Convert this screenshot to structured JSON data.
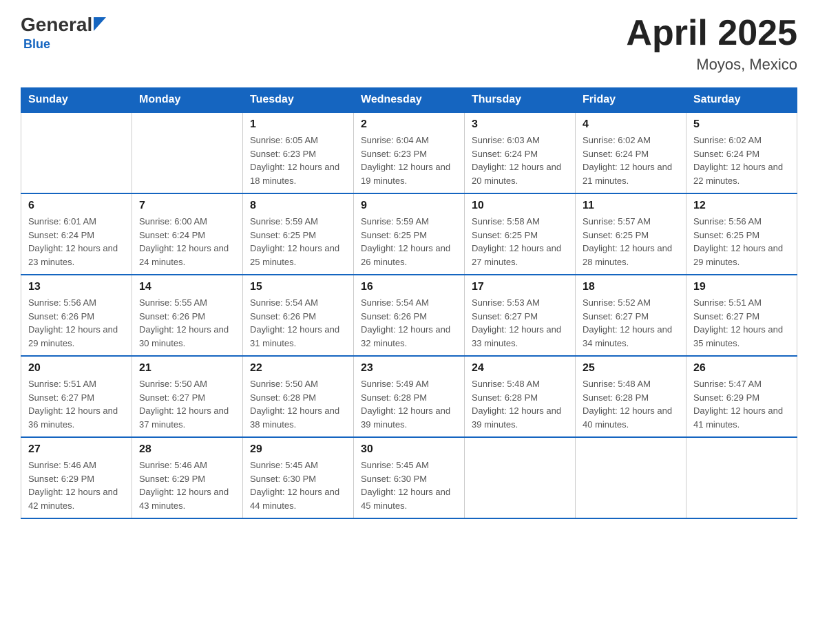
{
  "header": {
    "logo_general": "General",
    "logo_blue": "Blue",
    "month_year": "April 2025",
    "location": "Moyos, Mexico"
  },
  "days_of_week": [
    "Sunday",
    "Monday",
    "Tuesday",
    "Wednesday",
    "Thursday",
    "Friday",
    "Saturday"
  ],
  "weeks": [
    [
      {
        "day": "",
        "sunrise": "",
        "sunset": "",
        "daylight": ""
      },
      {
        "day": "",
        "sunrise": "",
        "sunset": "",
        "daylight": ""
      },
      {
        "day": "1",
        "sunrise": "Sunrise: 6:05 AM",
        "sunset": "Sunset: 6:23 PM",
        "daylight": "Daylight: 12 hours and 18 minutes."
      },
      {
        "day": "2",
        "sunrise": "Sunrise: 6:04 AM",
        "sunset": "Sunset: 6:23 PM",
        "daylight": "Daylight: 12 hours and 19 minutes."
      },
      {
        "day": "3",
        "sunrise": "Sunrise: 6:03 AM",
        "sunset": "Sunset: 6:24 PM",
        "daylight": "Daylight: 12 hours and 20 minutes."
      },
      {
        "day": "4",
        "sunrise": "Sunrise: 6:02 AM",
        "sunset": "Sunset: 6:24 PM",
        "daylight": "Daylight: 12 hours and 21 minutes."
      },
      {
        "day": "5",
        "sunrise": "Sunrise: 6:02 AM",
        "sunset": "Sunset: 6:24 PM",
        "daylight": "Daylight: 12 hours and 22 minutes."
      }
    ],
    [
      {
        "day": "6",
        "sunrise": "Sunrise: 6:01 AM",
        "sunset": "Sunset: 6:24 PM",
        "daylight": "Daylight: 12 hours and 23 minutes."
      },
      {
        "day": "7",
        "sunrise": "Sunrise: 6:00 AM",
        "sunset": "Sunset: 6:24 PM",
        "daylight": "Daylight: 12 hours and 24 minutes."
      },
      {
        "day": "8",
        "sunrise": "Sunrise: 5:59 AM",
        "sunset": "Sunset: 6:25 PM",
        "daylight": "Daylight: 12 hours and 25 minutes."
      },
      {
        "day": "9",
        "sunrise": "Sunrise: 5:59 AM",
        "sunset": "Sunset: 6:25 PM",
        "daylight": "Daylight: 12 hours and 26 minutes."
      },
      {
        "day": "10",
        "sunrise": "Sunrise: 5:58 AM",
        "sunset": "Sunset: 6:25 PM",
        "daylight": "Daylight: 12 hours and 27 minutes."
      },
      {
        "day": "11",
        "sunrise": "Sunrise: 5:57 AM",
        "sunset": "Sunset: 6:25 PM",
        "daylight": "Daylight: 12 hours and 28 minutes."
      },
      {
        "day": "12",
        "sunrise": "Sunrise: 5:56 AM",
        "sunset": "Sunset: 6:25 PM",
        "daylight": "Daylight: 12 hours and 29 minutes."
      }
    ],
    [
      {
        "day": "13",
        "sunrise": "Sunrise: 5:56 AM",
        "sunset": "Sunset: 6:26 PM",
        "daylight": "Daylight: 12 hours and 29 minutes."
      },
      {
        "day": "14",
        "sunrise": "Sunrise: 5:55 AM",
        "sunset": "Sunset: 6:26 PM",
        "daylight": "Daylight: 12 hours and 30 minutes."
      },
      {
        "day": "15",
        "sunrise": "Sunrise: 5:54 AM",
        "sunset": "Sunset: 6:26 PM",
        "daylight": "Daylight: 12 hours and 31 minutes."
      },
      {
        "day": "16",
        "sunrise": "Sunrise: 5:54 AM",
        "sunset": "Sunset: 6:26 PM",
        "daylight": "Daylight: 12 hours and 32 minutes."
      },
      {
        "day": "17",
        "sunrise": "Sunrise: 5:53 AM",
        "sunset": "Sunset: 6:27 PM",
        "daylight": "Daylight: 12 hours and 33 minutes."
      },
      {
        "day": "18",
        "sunrise": "Sunrise: 5:52 AM",
        "sunset": "Sunset: 6:27 PM",
        "daylight": "Daylight: 12 hours and 34 minutes."
      },
      {
        "day": "19",
        "sunrise": "Sunrise: 5:51 AM",
        "sunset": "Sunset: 6:27 PM",
        "daylight": "Daylight: 12 hours and 35 minutes."
      }
    ],
    [
      {
        "day": "20",
        "sunrise": "Sunrise: 5:51 AM",
        "sunset": "Sunset: 6:27 PM",
        "daylight": "Daylight: 12 hours and 36 minutes."
      },
      {
        "day": "21",
        "sunrise": "Sunrise: 5:50 AM",
        "sunset": "Sunset: 6:27 PM",
        "daylight": "Daylight: 12 hours and 37 minutes."
      },
      {
        "day": "22",
        "sunrise": "Sunrise: 5:50 AM",
        "sunset": "Sunset: 6:28 PM",
        "daylight": "Daylight: 12 hours and 38 minutes."
      },
      {
        "day": "23",
        "sunrise": "Sunrise: 5:49 AM",
        "sunset": "Sunset: 6:28 PM",
        "daylight": "Daylight: 12 hours and 39 minutes."
      },
      {
        "day": "24",
        "sunrise": "Sunrise: 5:48 AM",
        "sunset": "Sunset: 6:28 PM",
        "daylight": "Daylight: 12 hours and 39 minutes."
      },
      {
        "day": "25",
        "sunrise": "Sunrise: 5:48 AM",
        "sunset": "Sunset: 6:28 PM",
        "daylight": "Daylight: 12 hours and 40 minutes."
      },
      {
        "day": "26",
        "sunrise": "Sunrise: 5:47 AM",
        "sunset": "Sunset: 6:29 PM",
        "daylight": "Daylight: 12 hours and 41 minutes."
      }
    ],
    [
      {
        "day": "27",
        "sunrise": "Sunrise: 5:46 AM",
        "sunset": "Sunset: 6:29 PM",
        "daylight": "Daylight: 12 hours and 42 minutes."
      },
      {
        "day": "28",
        "sunrise": "Sunrise: 5:46 AM",
        "sunset": "Sunset: 6:29 PM",
        "daylight": "Daylight: 12 hours and 43 minutes."
      },
      {
        "day": "29",
        "sunrise": "Sunrise: 5:45 AM",
        "sunset": "Sunset: 6:30 PM",
        "daylight": "Daylight: 12 hours and 44 minutes."
      },
      {
        "day": "30",
        "sunrise": "Sunrise: 5:45 AM",
        "sunset": "Sunset: 6:30 PM",
        "daylight": "Daylight: 12 hours and 45 minutes."
      },
      {
        "day": "",
        "sunrise": "",
        "sunset": "",
        "daylight": ""
      },
      {
        "day": "",
        "sunrise": "",
        "sunset": "",
        "daylight": ""
      },
      {
        "day": "",
        "sunrise": "",
        "sunset": "",
        "daylight": ""
      }
    ]
  ]
}
